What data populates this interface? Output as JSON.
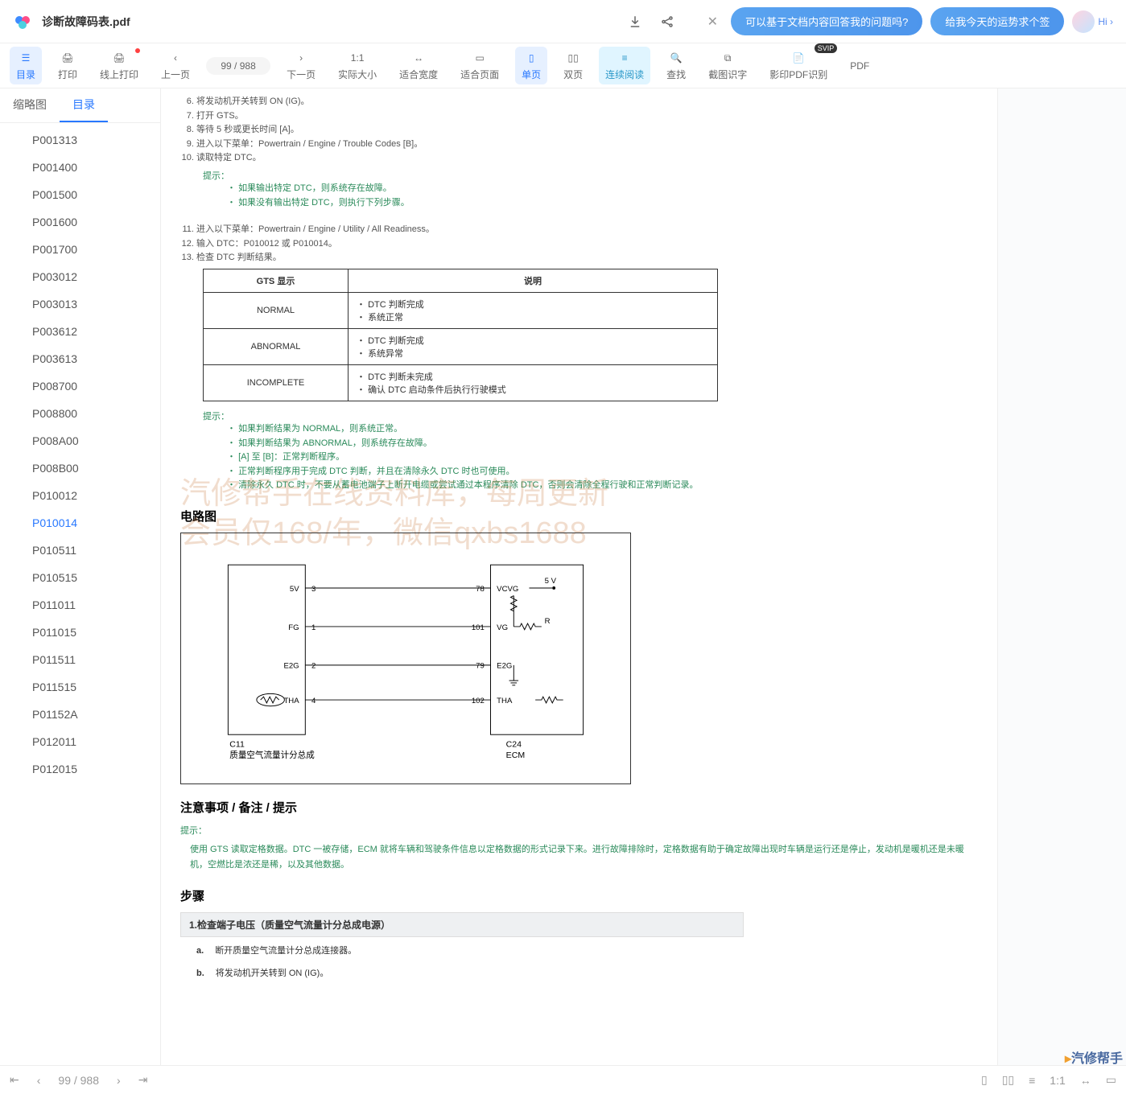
{
  "filename": "诊断故障码表.pdf",
  "ai": {
    "pill1": "可以基于文档内容回答我的问题吗?",
    "pill2": "给我今天的运势求个签",
    "hi": "Hi ›"
  },
  "toolbar": {
    "toc": "目录",
    "print": "打印",
    "onlinePrint": "线上打印",
    "prev": "上一页",
    "pageDisplay": "99 / 988",
    "next": "下一页",
    "actual": "实际大小",
    "fitWidth": "适合宽度",
    "fitPage": "适合页面",
    "single": "单页",
    "double": "双页",
    "continuous": "连续阅读",
    "find": "查找",
    "ocr": "截图识字",
    "scan": "影印PDF识别",
    "pdf": "PDF"
  },
  "sideTabs": {
    "thumb": "缩略图",
    "toc": "目录"
  },
  "toc": [
    "P001313",
    "P001400",
    "P001500",
    "P001600",
    "P001700",
    "P003012",
    "P003013",
    "P003612",
    "P003613",
    "P008700",
    "P008800",
    "P008A00",
    "P008B00",
    "P010012",
    "P010014",
    "P010511",
    "P010515",
    "P011011",
    "P011015",
    "P011511",
    "P011515",
    "P01152A",
    "P012011",
    "P012015"
  ],
  "tocActive": "P010014",
  "doc": {
    "startNum": 6,
    "steps1": [
      "将发动机开关转到 ON (IG)。",
      "打开 GTS。",
      "等待 5 秒或更长时间 [A]。",
      "进入以下菜单：Powertrain / Engine / Trouble Codes [B]。",
      "读取特定 DTC。"
    ],
    "hintLabel": "提示：",
    "hint1": [
      "如果输出特定 DTC，则系统存在故障。",
      "如果没有输出特定 DTC，则执行下列步骤。"
    ],
    "steps2": [
      "进入以下菜单：Powertrain / Engine / Utility / All Readiness。",
      "输入 DTC：P010012 或 P010014。",
      "检查 DTC 判断结果。"
    ],
    "table": {
      "h1": "GTS 显示",
      "h2": "说明",
      "rows": [
        {
          "l": "NORMAL",
          "r": [
            "DTC 判断完成",
            "系统正常"
          ]
        },
        {
          "l": "ABNORMAL",
          "r": [
            "DTC 判断完成",
            "系统异常"
          ]
        },
        {
          "l": "INCOMPLETE",
          "r": [
            "DTC 判断未完成",
            "确认 DTC 启动条件后执行行驶模式"
          ]
        }
      ]
    },
    "hint2": [
      "如果判断结果为 NORMAL，则系统正常。",
      "如果判断结果为 ABNORMAL，则系统存在故障。",
      "[A] 至 [B]：正常判断程序。",
      "正常判断程序用于完成 DTC 判断，并且在清除永久 DTC 时也可使用。",
      "清除永久 DTC 时，不要从蓄电池端子上断开电缆或尝试通过本程序清除 DTC，否则会清除全程行驶和正常判断记录。"
    ],
    "circuit": {
      "heading": "电路图",
      "c11": "C11",
      "c11name": "质量空气流量计分总成",
      "c24": "C24",
      "ecm": "ECM",
      "p5v": "5V",
      "p3": "3",
      "p78": "78",
      "vcvg": "VCVG",
      "v5v": "5 V",
      "fg": "FG",
      "p1": "1",
      "p101": "101",
      "vg": "VG",
      "r": "R",
      "e2g": "E2G",
      "p2": "2",
      "p79": "79",
      "tha": "THA",
      "p4": "4",
      "p102": "102"
    },
    "notesHeading": "注意事项 / 备注 / 提示",
    "noteHint": "提示：",
    "noteBody": "使用 GTS 读取定格数据。DTC 一被存储，ECM 就将车辆和驾驶条件信息以定格数据的形式记录下来。进行故障排除时，定格数据有助于确定故障出现时车辆是运行还是停止，发动机是暖机还是未暖机，空燃比是浓还是稀，以及其他数据。",
    "procHeading": "步骤",
    "step1title": "1.检查端子电压（质量空气流量计分总成电源）",
    "s1a": "a.",
    "s1aText": "断开质量空气流量计分总成连接器。",
    "s1b": "b.",
    "s1bText": "将发动机开关转到 ON (IG)。"
  },
  "watermark": {
    "l1": "汽修帮手在线资料库，每周更新",
    "l2": "会员仅168/年，微信qxbs1688"
  },
  "footer": {
    "first": "⏮",
    "prev": "‹",
    "page": "99 / 988",
    "next": "›",
    "last": "⏭"
  },
  "brand": "汽修帮手"
}
